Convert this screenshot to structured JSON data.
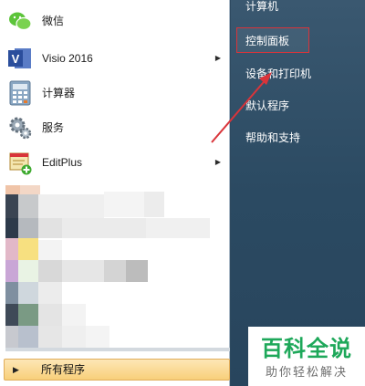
{
  "programs": [
    {
      "label": "微信",
      "icon": "wechat-icon",
      "has_submenu": false
    },
    {
      "label": "Visio 2016",
      "icon": "visio-icon",
      "has_submenu": true
    },
    {
      "label": "计算器",
      "icon": "calculator-icon",
      "has_submenu": false
    },
    {
      "label": "服务",
      "icon": "services-gear-icon",
      "has_submenu": false
    },
    {
      "label": "EditPlus",
      "icon": "editplus-icon",
      "has_submenu": true
    }
  ],
  "all_programs": {
    "label": "所有程序",
    "arrow": "▶"
  },
  "submenu_arrow": "▶",
  "right_menu": {
    "items": [
      {
        "label": "计算机"
      },
      {
        "label": "控制面板",
        "highlighted": true
      },
      {
        "label": "设备和打印机"
      },
      {
        "label": "默认程序"
      },
      {
        "label": "帮助和支持"
      }
    ]
  },
  "annotation": {
    "box_color": "#d9343a",
    "arrow_color": "#d9343a"
  },
  "watermark": {
    "title": "百科全说",
    "subtitle": "助你轻松解决",
    "color": "#1ea85a"
  }
}
